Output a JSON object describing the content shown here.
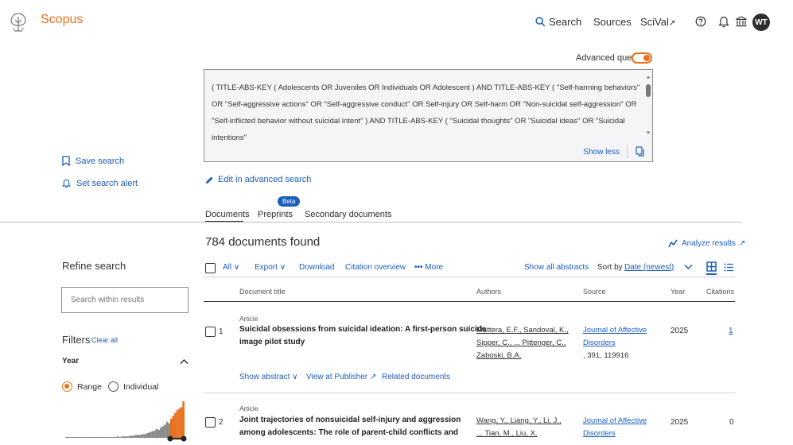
{
  "header": {
    "brand": "Scopus",
    "nav": {
      "search": "Search",
      "sources": "Sources",
      "scival": "SciVal",
      "scival_ext": "↗"
    },
    "avatar_initials": "WT"
  },
  "query": {
    "advanced_label": "Advanced query",
    "text": "( TITLE-ABS-KEY ( Adolescents OR Juveniles OR Individuals OR Adolescent ) AND TITLE-ABS-KEY ( \"Self-harming behaviors\" OR \"Self-aggressive actions\" OR \"Self-aggressive conduct\" OR Self-injury OR Self-harm OR \"Non-suicidal self-aggression\" OR \"Self-inflicted behavior without suicidal intent\" ) AND TITLE-ABS-KEY ( \"Suicidal thoughts\" OR \"Suicidal ideas\" OR \"Suicidal intentions\"",
    "show_less": "Show less",
    "edit_advanced": "Edit in advanced search"
  },
  "left_actions": {
    "save_search": "Save search",
    "set_alert": "Set search alert"
  },
  "tabs": {
    "documents": "Documents",
    "preprints": "Preprints",
    "preprints_badge": "Beta",
    "secondary": "Secondary documents"
  },
  "results": {
    "count_text": "784 documents found",
    "analyze": "Analyze results",
    "analyze_ext": "↗",
    "toolbar": {
      "all": "All",
      "export": "Export",
      "download": "Download",
      "citation_overview": "Citation overview",
      "more": "More",
      "show_all_abstracts": "Show all abstracts",
      "sort_by": "Sort by",
      "sort_value": "Date (newest)"
    },
    "columns": {
      "title": "Document title",
      "authors": "Authors",
      "source": "Source",
      "year": "Year",
      "citations": "Citations"
    },
    "rows": [
      {
        "index": "1",
        "type": "Article",
        "title_line1": "Suicidal obsessions from suicidal ideation: A first-person suicide",
        "title_line2": "image pilot study",
        "authors_line1": "Mattera, E.F., Sandoval, K.,",
        "authors_line2": "Sipper, C., ... Pittenger, C.,",
        "authors_line3": "Zaboski, B.A.",
        "source_line1": "Journal of Affective",
        "source_line2": "Disorders",
        "source_line3": ", 391, 119916",
        "year": "2025",
        "citations": "1",
        "show_abstract": "Show abstract",
        "view_publisher": "View at Publisher",
        "view_publisher_ext": "↗",
        "related": "Related documents"
      },
      {
        "index": "2",
        "type": "Article",
        "title_line1": "Joint trajectories of nonsuicidal self-injury and aggression",
        "title_line2": "among adolescents: The role of parent-child conflicts and",
        "authors_line1": "Wang, Y., Liang, Y., Li, J.,",
        "authors_line2": "... Tian, M., Liu, X.",
        "source_line1": "Journal of Affective",
        "source_line2": "Disorders",
        "year": "2025",
        "citations": "0"
      }
    ]
  },
  "refine": {
    "title": "Refine search",
    "search_placeholder": "Search within results",
    "filters": "Filters",
    "clear_all": "Clear all",
    "year": "Year",
    "range": "Range",
    "individual": "Individual"
  },
  "year_histogram": [
    1,
    1,
    1,
    1,
    1,
    1,
    1,
    1,
    1,
    1,
    1,
    1,
    1,
    1,
    1,
    1,
    1,
    1,
    1,
    1,
    1,
    1,
    1,
    1,
    1,
    2,
    1,
    2,
    2,
    2,
    2,
    3,
    3,
    3,
    4,
    4,
    4,
    5,
    5,
    6,
    7,
    8,
    9,
    10,
    12,
    11,
    14,
    16,
    18,
    22,
    20,
    26,
    30,
    34,
    38,
    40,
    42,
    50
  ],
  "histogram_highlight_last": 7,
  "colors": {
    "accent": "#e9711c",
    "link": "#1b5ebe",
    "bar": "#8a8a8a"
  }
}
